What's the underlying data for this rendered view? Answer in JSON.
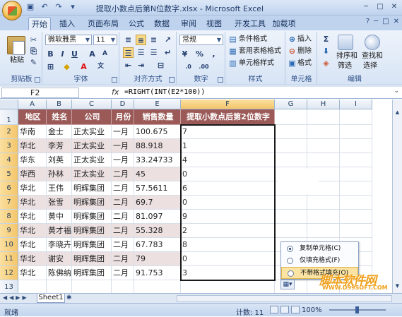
{
  "window": {
    "title": "提取小数点后第N位数字.xlsx - Microsoft Excel",
    "minimize": "─",
    "maximize": "□",
    "close": "✕"
  },
  "tabs": [
    "开始",
    "插入",
    "页面布局",
    "公式",
    "数据",
    "审阅",
    "视图",
    "开发工具",
    "加载项"
  ],
  "ribbon": {
    "clipboard": {
      "label": "剪贴板",
      "paste": "粘贴"
    },
    "font": {
      "label": "字体",
      "name": "微软雅黑",
      "size": "11"
    },
    "alignment": {
      "label": "对齐方式"
    },
    "number": {
      "label": "数字",
      "format": "常规"
    },
    "styles": {
      "label": "样式",
      "cond": "条件格式",
      "table": "套用表格格式",
      "cell": "单元格样式"
    },
    "cells": {
      "label": "单元格",
      "insert": "插入",
      "delete": "删除",
      "format": "格式"
    },
    "editing": {
      "label": "编辑",
      "sort": "排序和",
      "sort2": "筛选",
      "find": "查找和",
      "find2": "选择"
    }
  },
  "formula_bar": {
    "name_box": "F2",
    "fx": "fx",
    "formula": "=RIGHT(INT(E2*100))"
  },
  "columns": [
    "A",
    "B",
    "C",
    "D",
    "E",
    "F",
    "G",
    "H",
    "I"
  ],
  "rows": [
    "1",
    "2",
    "3",
    "4",
    "5",
    "6",
    "7",
    "8",
    "9",
    "10",
    "11",
    "12",
    "13"
  ],
  "table": {
    "headers": [
      "地区",
      "姓名",
      "公司",
      "月份",
      "销售数量",
      "提取小数点后第2位数字"
    ],
    "data": [
      [
        "华南",
        "金士",
        "正太实业",
        "一月",
        "100.675",
        "7"
      ],
      [
        "华北",
        "李芳",
        "正太实业",
        "一月",
        "88.918",
        "1"
      ],
      [
        "华东",
        "刘英",
        "正太实业",
        "一月",
        "33.24733",
        "4"
      ],
      [
        "华西",
        "孙林",
        "正太实业",
        "二月",
        "45",
        "0"
      ],
      [
        "华北",
        "王伟",
        "明辉集团",
        "二月",
        "57.5611",
        "6"
      ],
      [
        "华北",
        "张雪",
        "明辉集团",
        "二月",
        "69.7",
        "0"
      ],
      [
        "华北",
        "黄中",
        "明辉集团",
        "二月",
        "81.097",
        "9"
      ],
      [
        "华北",
        "黄才福",
        "明辉集团",
        "二月",
        "55.328",
        "2"
      ],
      [
        "华北",
        "李晓卉",
        "明辉集团",
        "二月",
        "67.783",
        "8"
      ],
      [
        "华北",
        "谢安",
        "明辉集团",
        "二月",
        "79",
        "0"
      ],
      [
        "华北",
        "陈佛纳",
        "明辉集团",
        "二月",
        "91.753",
        "3"
      ]
    ]
  },
  "paste_options": [
    {
      "label": "复制单元格(C)",
      "selected": true
    },
    {
      "label": "仅填充格式(F)",
      "selected": false
    },
    {
      "label": "不带格式填充(O)",
      "selected": false
    }
  ],
  "sheet_tabs": [
    "Sheet1"
  ],
  "status": {
    "ready": "就绪",
    "count": "计数: 11",
    "zoom": "100%"
  },
  "watermark": {
    "line1": "脚本软件网",
    "line2": "WWW.D99SOFT.COM"
  }
}
